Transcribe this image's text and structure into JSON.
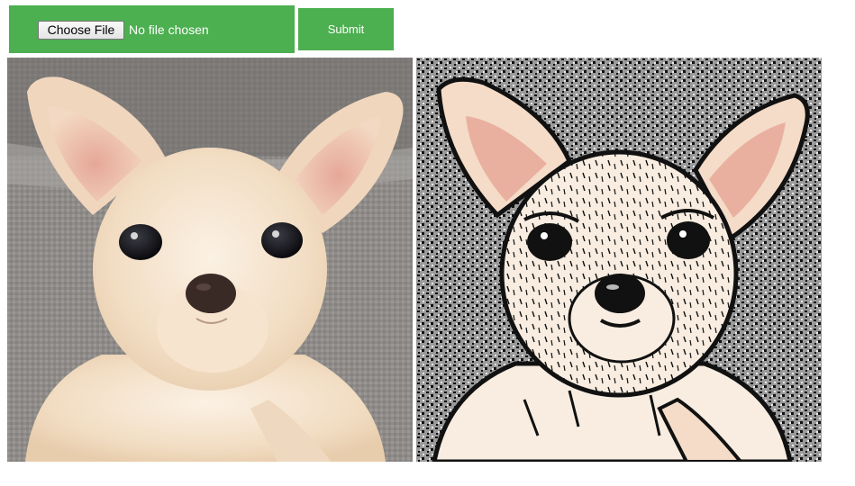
{
  "upload_form": {
    "choose_file_label": "Choose File",
    "file_status": "No file chosen",
    "submit_label": "Submit"
  },
  "images": {
    "original": {
      "subject": "chihuahua puppy photo",
      "colors": {
        "fur": "#f4e3cc",
        "background": "#8f8c8a",
        "ears": "#e9b9a6"
      }
    },
    "processed": {
      "subject": "chihuahua puppy cartoonized",
      "colors": {
        "fur": "#f8ede0",
        "background": "#8a8a8a",
        "ink": "#111111"
      }
    }
  },
  "colors": {
    "accent": "#4caf50",
    "button_text": "#ffffff"
  }
}
